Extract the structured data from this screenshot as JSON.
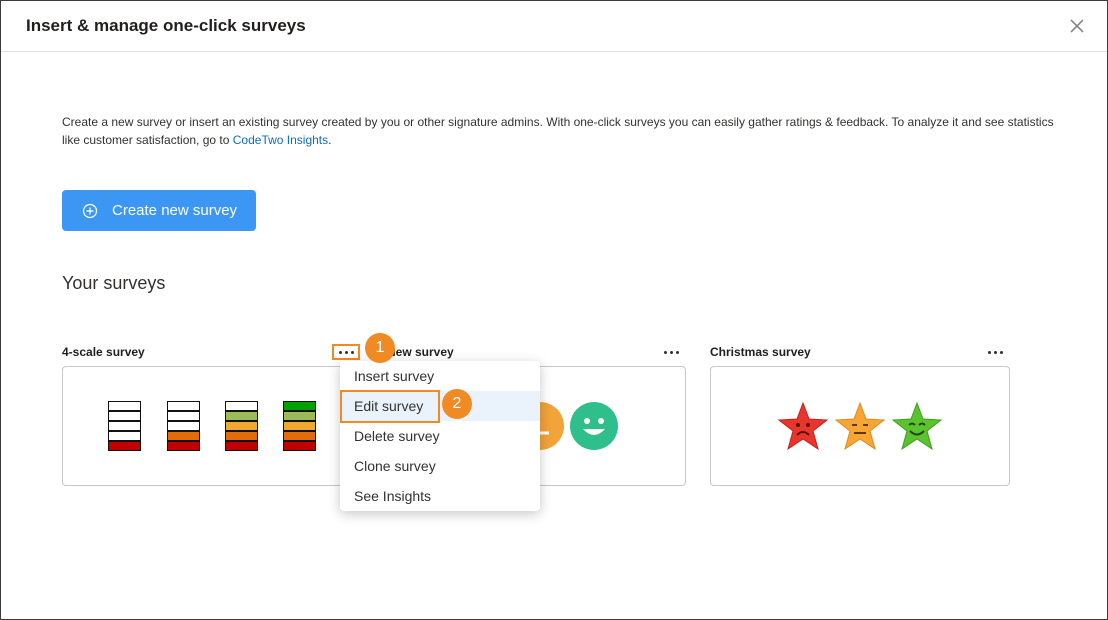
{
  "dialog": {
    "title": "Insert & manage one-click surveys",
    "close_icon": "close-icon"
  },
  "description": {
    "text_before_link": "Create a new survey or insert an existing survey created by you or other signature admins. With one-click surveys you can easily gather ratings & feedback. To analyze it and see statistics like customer satisfaction, go to ",
    "link": "CodeTwo Insights",
    "text_after_link": "."
  },
  "create_button": {
    "label": "Create new survey",
    "icon": "plus-circle-icon"
  },
  "section_title": "Your surveys",
  "surveys": [
    {
      "title": "4-scale survey"
    },
    {
      "title": "New survey",
      "visible_title": "New survey"
    },
    {
      "title": "Christmas survey"
    }
  ],
  "context_menu": {
    "items": [
      "Insert survey",
      "Edit survey",
      "Delete survey",
      "Clone survey",
      "See Insights"
    ],
    "active": "Edit survey"
  },
  "badges": [
    "1",
    "2"
  ],
  "colors": {
    "primary_button": "#3b97f3",
    "highlight": "#f08a24",
    "link": "#0f6cbd",
    "menu_active": "#eaf3fc",
    "bar_red": "#c00000",
    "bar_orange": "#e36c0a",
    "bar_amber": "#f0a830",
    "bar_lightgreen": "#9bbb59",
    "bar_green": "#00a000",
    "smiley_green": "#2fbf8c",
    "smiley_orange": "#f2a33a"
  }
}
